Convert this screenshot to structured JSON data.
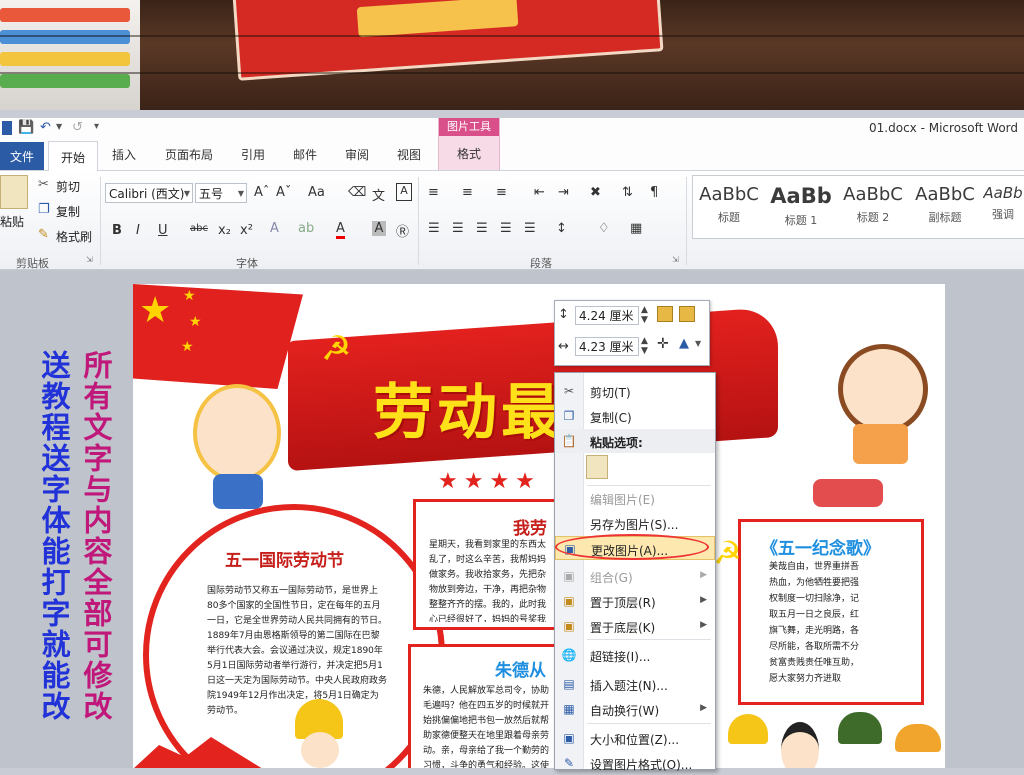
{
  "window": {
    "title": "01.docx - Microsoft Word"
  },
  "tabs": [
    "文件",
    "开始",
    "插入",
    "页面布局",
    "引用",
    "邮件",
    "审阅",
    "视图",
    "格式"
  ],
  "picture_tools": {
    "header": "图片工具",
    "tab": "格式"
  },
  "clipboard": {
    "paste": "粘贴",
    "cut": "剪切",
    "copy": "复制",
    "format_painter": "格式刷",
    "group": "剪贴板"
  },
  "font": {
    "name": "Calibri (西文)",
    "size": "五号",
    "group": "字体"
  },
  "paragraph": {
    "group": "段落"
  },
  "styles": [
    {
      "sample": "AaBbC",
      "name": "标题"
    },
    {
      "sample": "AaBb",
      "name": "标题 1"
    },
    {
      "sample": "AaBbC",
      "name": "标题 2"
    },
    {
      "sample": "AaBbC",
      "name": "副标题"
    },
    {
      "sample": "AaBb",
      "name": "强调"
    }
  ],
  "mini_toolbar": {
    "height": "4.24 厘米",
    "width": "4.23 厘米"
  },
  "context_menu": [
    {
      "label": "剪切(T)",
      "icon": "scissors-icon",
      "enabled": true
    },
    {
      "label": "复制(C)",
      "icon": "copy-icon",
      "enabled": true
    },
    {
      "label": "粘贴选项:",
      "icon": "paste-icon",
      "enabled": true,
      "bold": true
    },
    {
      "label": "编辑图片(E)",
      "icon": "",
      "enabled": false
    },
    {
      "label": "另存为图片(S)...",
      "icon": "",
      "enabled": true
    },
    {
      "label": "更改图片(A)...",
      "icon": "change-picture-icon",
      "enabled": true,
      "highlighted": true
    },
    {
      "label": "组合(G)",
      "icon": "group-icon",
      "enabled": false,
      "submenu": true
    },
    {
      "label": "置于顶层(R)",
      "icon": "bring-front-icon",
      "enabled": true,
      "submenu": true
    },
    {
      "label": "置于底层(K)",
      "icon": "send-back-icon",
      "enabled": true,
      "submenu": true
    },
    {
      "label": "超链接(I)...",
      "icon": "hyperlink-icon",
      "enabled": true
    },
    {
      "label": "插入题注(N)...",
      "icon": "caption-icon",
      "enabled": true
    },
    {
      "label": "自动换行(W)",
      "icon": "wrap-icon",
      "enabled": true,
      "submenu": true
    },
    {
      "label": "大小和位置(Z)...",
      "icon": "size-icon",
      "enabled": true
    },
    {
      "label": "设置图片格式(O)...",
      "icon": "format-icon",
      "enabled": true
    }
  ],
  "promo": {
    "left_col": "送教程送字体能打字就能改",
    "right_col": "所有文字与内容全部可修改"
  },
  "poster": {
    "title": "劳动最光荣",
    "section1_title": "五一国际劳动节",
    "section1_text": "国际劳动节又称五一国际劳动节，是世界上80多个国家的全国性节日，定在每年的五月一日，它是全世界劳动人民共同拥有的节日。1889年7月由恩格斯领导的第二国际在巴黎举行代表大会。会议通过决议，规定1890年5月1日国际劳动者举行游行，并决定把5月1日这一天定为国际劳动节。中央人民政府政务院1949年12月作出决定，将5月1日确定为劳动节。",
    "section2_title": "我劳",
    "section2_text": "星期天，我看到家里的东西太乱了，时这么辛苦，我帮妈妈做家务。我收拾家务，先把杂物放到旁边，干净，再把杂物整整齐齐的摆。我的，此时我心已经很好了，妈妈的号奖我心里甜滋滋的。我欲",
    "section3_title": "朱德从",
    "section3_text": "朱德，人民解放军总司令，协助毛遍吗？他在四五岁的时候就开始挑偏偏地把书包一放然后就帮助家德便整天在地里跟着母亲劳动。亲，母亲给了我一个勤劳的习惯，斗争的勇气和经验。这使我在以后也没有感到过困难，没有被困难所吓倒。",
    "song_title": "《五一纪念歌》",
    "song_text": "美哉自由，世界重拼吾热血，为他牺牲要把强权制度一切扫除净，记取五月一日之良辰，红旗飞舞，走光明路，各尽所能，各取所需不分贫富贵贱责任唯互助，愿大家努力齐进取"
  }
}
